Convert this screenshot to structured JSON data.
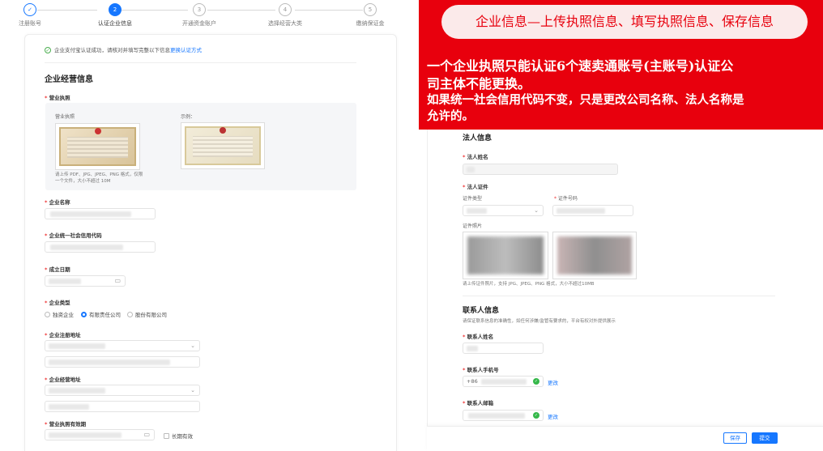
{
  "steps": [
    {
      "num": "✓",
      "label": "注册账号"
    },
    {
      "num": "2",
      "label": "认证企业信息"
    },
    {
      "num": "3",
      "label": "开通资金账户"
    },
    {
      "num": "4",
      "label": "选择经营大类"
    },
    {
      "num": "5",
      "label": "缴纳保证金"
    }
  ],
  "notice": {
    "text": "企业支付宝认证成功，请核对并填写完整以下信息",
    "link": "更换认证方式"
  },
  "left": {
    "section_title": "企业经营信息",
    "license_label": "营业执照",
    "license_upload_label": "营业执照",
    "example_label": "示例：",
    "upload_hint": "请上传 PDF、JPG、JPEG、PNG 格式，仅限一个文件，大小不超过 10M",
    "company_name_label": "企业名称",
    "credit_code_label": "企业统一社会信用代码",
    "found_date_label": "成立日期",
    "company_type_label": "企业类型",
    "company_types": [
      "独资企业",
      "有限责任公司",
      "股份有限公司"
    ],
    "reg_address_label": "企业注册地址",
    "biz_address_label": "企业经营地址",
    "license_valid_label": "营业执照有效期",
    "long_term_label": "长期有效"
  },
  "banner": {
    "title": "企业信息—上传执照信息、填写执照信息、保存信息",
    "line1": "一个企业执照只能认证6个速卖通账号(主账号)认证公",
    "line2": "司主体不能更换。",
    "line3": "如果统一社会信用代码不变，只是更改公司名称、法人名称是",
    "line4": "允许的。"
  },
  "right": {
    "legal_section": "法人信息",
    "legal_name_label": "法人姓名",
    "legal_id_label": "法人证件",
    "id_type_label": "证件类型",
    "id_number_label": "证件号码",
    "id_photo_label": "证件照片",
    "id_photo_hint": "请上传证件照片，支持 JPG、JPEG、PNG 格式，大小不超过10MB",
    "contact_section": "联系人信息",
    "contact_hint": "请保证联系信息的准确性，如任何涉嫌/监管有要求的，平台有权对外提供展示",
    "contact_name_label": "联系人姓名",
    "contact_phone_label": "联系人手机号",
    "phone_prefix": "+86",
    "change_link": "更改",
    "contact_email_label": "联系人邮箱"
  },
  "footer": {
    "save": "保存",
    "submit": "提交"
  },
  "colors": {
    "accent": "#1677ff",
    "banner": "#e8000d",
    "success": "#35b84a"
  }
}
